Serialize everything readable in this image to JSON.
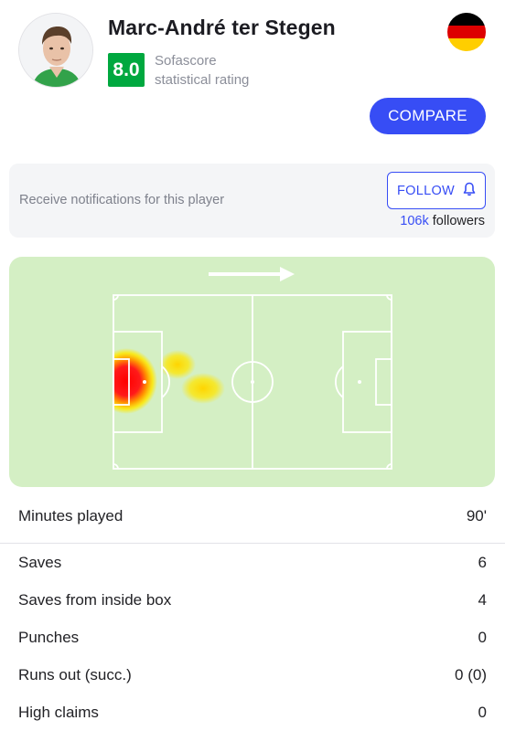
{
  "player": {
    "name": "Marc-André ter Stegen",
    "rating": "8.0",
    "rating_label_line1": "Sofascore",
    "rating_label_line2": "statistical rating",
    "avatar_icon": "player-avatar",
    "flag_icon": "germany-flag-icon"
  },
  "actions": {
    "compare_label": "COMPARE"
  },
  "follow": {
    "prompt": "Receive notifications for this player",
    "button_label": "FOLLOW",
    "button_icon": "bell-icon",
    "followers_count": "106k",
    "followers_suffix": " followers"
  },
  "heatmap": {
    "direction_icon": "arrow-right-icon",
    "colors": {
      "pitch": "#d4efc4",
      "lines": "#ffffff",
      "hot": "#ff1a1a",
      "warm": "#ffe000"
    }
  },
  "stats": {
    "primary": {
      "label": "Minutes played",
      "value": "90'"
    },
    "rows": [
      {
        "label": "Saves",
        "value": "6"
      },
      {
        "label": "Saves from inside box",
        "value": "4"
      },
      {
        "label": "Punches",
        "value": "0"
      },
      {
        "label": "Runs out (succ.)",
        "value": "0 (0)"
      },
      {
        "label": "High claims",
        "value": "0"
      }
    ]
  },
  "colors": {
    "accent": "#374df5",
    "rating_green": "#00a83f"
  }
}
